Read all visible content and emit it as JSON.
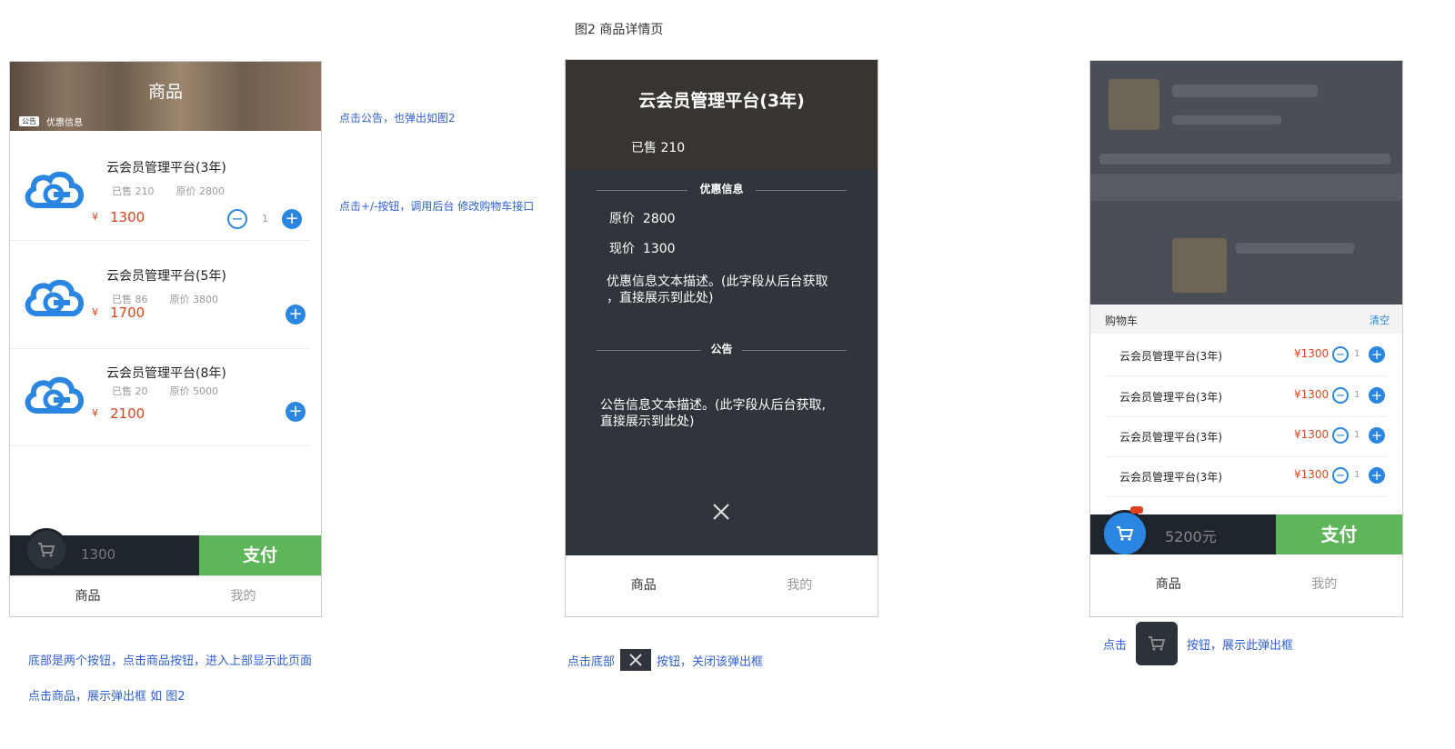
{
  "top_caption": "图2 商品详情页",
  "phone1": {
    "banner_title": "商品",
    "notice_tag": "公告",
    "notice_text": "优惠信息",
    "products": [
      {
        "name": "云会员管理平台(3年)",
        "sold": "已售 210",
        "orig": "原价 2800",
        "yen": "¥",
        "price": "1300",
        "qty": "1"
      },
      {
        "name": "云会员管理平台(5年)",
        "sold": "已售 86",
        "orig": "原价 3800",
        "yen": "¥",
        "price": "1700"
      },
      {
        "name": "云会员管理平台(8年)",
        "sold": "已售 20",
        "orig": "原价 5000",
        "yen": "¥",
        "price": "2100"
      }
    ],
    "cart_total": "1300",
    "pay_label": "支付",
    "tab_goods": "商品",
    "tab_mine": "我的"
  },
  "notes": {
    "announcement": "点击公告，也弹出如图2",
    "plus_minus": "点击+/-按钮，调用后台 修改购物车接口",
    "bottom_buttons": "底部是两个按钮，点击商品按钮，进入上部显示此页面",
    "click_goods": "点击商品，展示弹出框 如 图2",
    "close_prefix": "点击底部",
    "close_suffix": "按钮，关闭该弹出框",
    "cart_prefix": "点击",
    "cart_suffix": "按钮，展示此弹出框"
  },
  "phone2": {
    "title": "云会员管理平台(3年)",
    "sold": "已售 210",
    "discount_header": "优惠信息",
    "orig_label": "原价",
    "orig_value": "2800",
    "now_label": "现价",
    "now_value": "1300",
    "discount_desc_1": "优惠信息文本描述。(此字段从后台获取",
    "discount_desc_2": "，直接展示到此处)",
    "notice_header": "公告",
    "notice_desc_1": "公告信息文本描述。(此字段从后台获取,",
    "notice_desc_2": "直接展示到此处)",
    "tab_goods": "商品",
    "tab_mine": "我的"
  },
  "phone3": {
    "cart_title": "购物车",
    "clear": "清空",
    "items": [
      {
        "name": "云会员管理平台(3年)",
        "price": "¥1300",
        "qty": "1"
      },
      {
        "name": "云会员管理平台(3年)",
        "price": "¥1300",
        "qty": "1"
      },
      {
        "name": "云会员管理平台(3年)",
        "price": "¥1300",
        "qty": "1"
      },
      {
        "name": "云会员管理平台(3年)",
        "price": "¥1300",
        "qty": "1"
      }
    ],
    "total": "5200元",
    "pay_label": "支付",
    "tab_goods": "商品",
    "tab_mine": "我的"
  },
  "colors": {
    "accent": "#2a86e0",
    "price": "#e0431c",
    "pay": "#5fb55a",
    "note": "#2f5fd6",
    "dark": "#1e252d"
  }
}
